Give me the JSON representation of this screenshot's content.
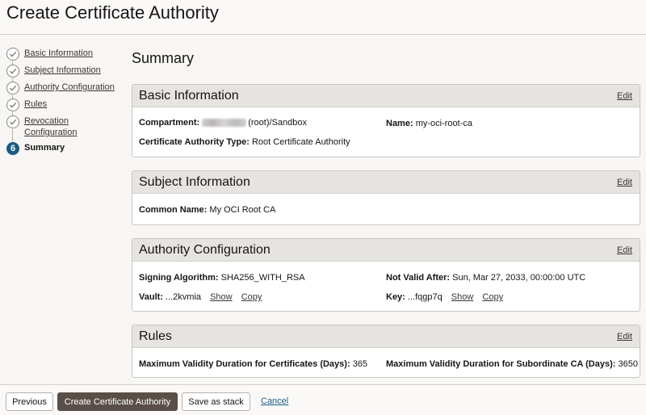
{
  "header": {
    "title": "Create Certificate Authority"
  },
  "steps": [
    {
      "label": "Basic Information",
      "state": "done"
    },
    {
      "label": "Subject Information",
      "state": "done"
    },
    {
      "label": "Authority Configuration",
      "state": "done"
    },
    {
      "label": "Rules",
      "state": "done"
    },
    {
      "label": "Revocation Configuration",
      "state": "done"
    },
    {
      "label": "Summary",
      "state": "current",
      "number": "6"
    }
  ],
  "summary_title": "Summary",
  "edit_label": "Edit",
  "basic": {
    "title": "Basic Information",
    "compartment_label": "Compartment:",
    "compartment_value": "(root)/Sandbox",
    "name_label": "Name:",
    "name_value": "my-oci-root-ca",
    "type_label": "Certificate Authority Type:",
    "type_value": "Root Certificate Authority"
  },
  "subject": {
    "title": "Subject Information",
    "common_name_label": "Common Name:",
    "common_name_value": "My OCI Root CA"
  },
  "authority": {
    "title": "Authority Configuration",
    "signing_label": "Signing Algorithm:",
    "signing_value": "SHA256_WITH_RSA",
    "not_valid_after_label": "Not Valid After:",
    "not_valid_after_value": "Sun, Mar 27, 2033, 00:00:00 UTC",
    "vault_label": "Vault:",
    "vault_value": "...2kvmia",
    "key_label": "Key:",
    "key_value": "...fqgp7q",
    "show_label": "Show",
    "copy_label": "Copy"
  },
  "rules": {
    "title": "Rules",
    "max_cert_label": "Maximum Validity Duration for Certificates (Days):",
    "max_cert_value": "365",
    "max_sub_label": "Maximum Validity Duration for Subordinate CA (Days):",
    "max_sub_value": "3650"
  },
  "footer": {
    "previous": "Previous",
    "create": "Create Certificate Authority",
    "save_stack": "Save as stack",
    "cancel": "Cancel"
  },
  "colors": {
    "accent": "#1c5b86",
    "primary_button": "#5a4f48"
  },
  "icons": {
    "done": "check-icon"
  }
}
